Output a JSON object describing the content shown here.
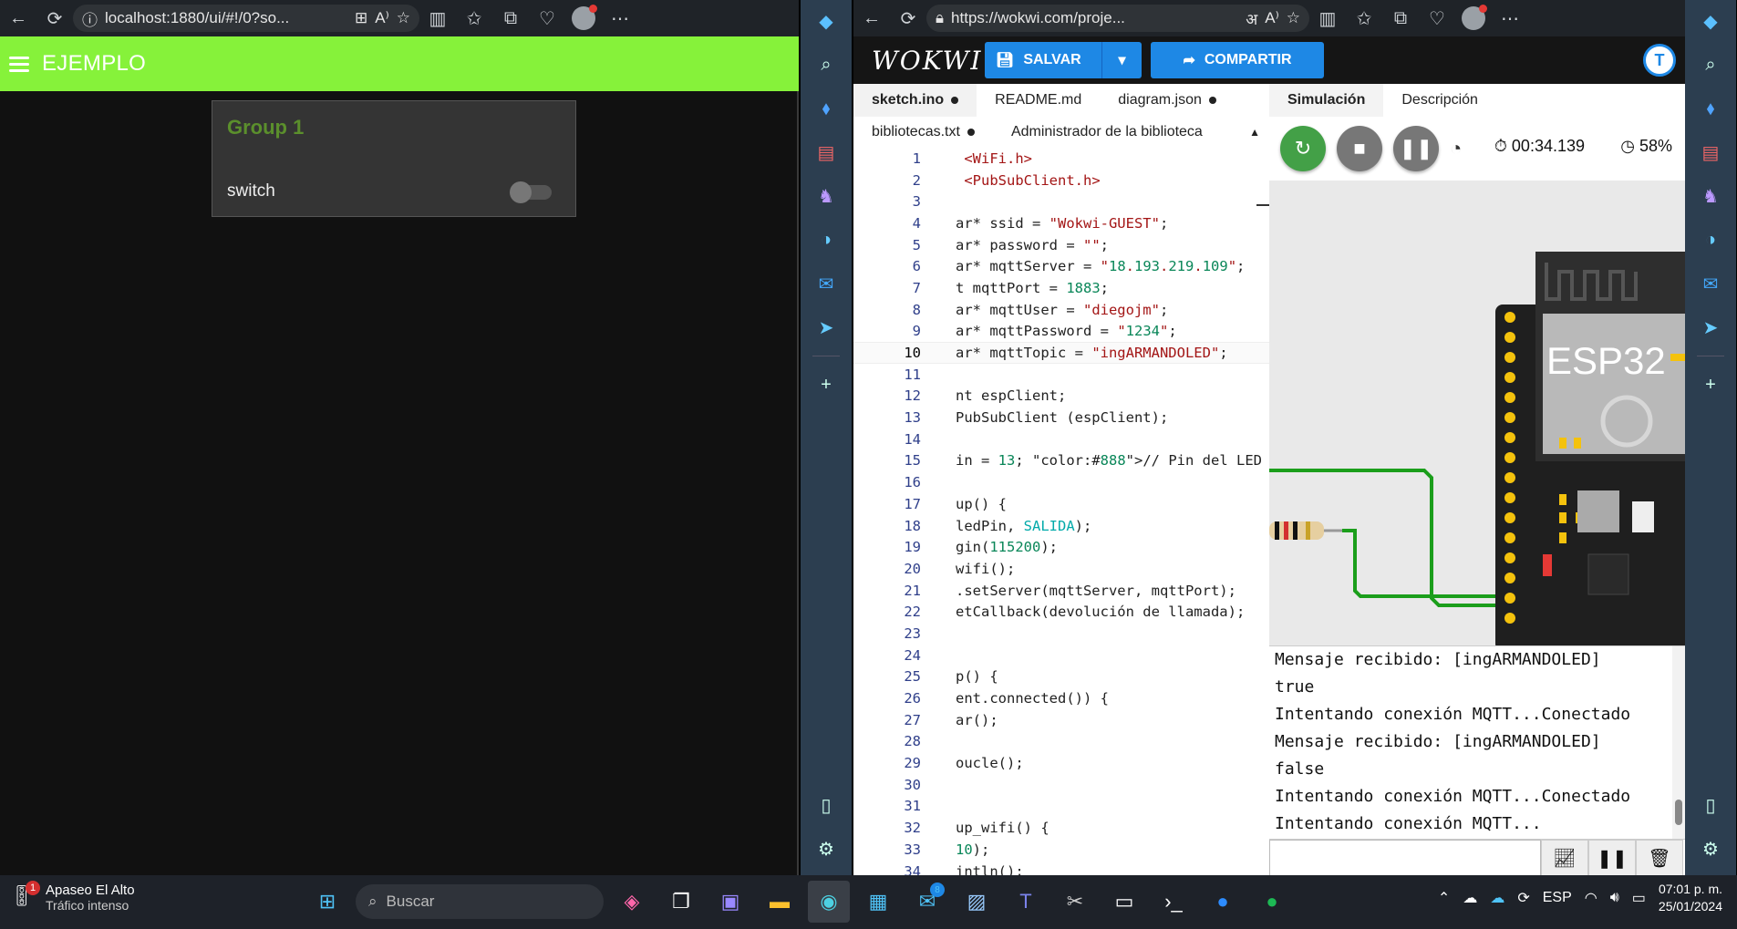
{
  "left_browser": {
    "url": "localhost:1880/ui/#!/0?so...",
    "header_title": "EJEMPLO",
    "group_title": "Group 1",
    "switch_label": "switch",
    "switch_on": false
  },
  "right_browser": {
    "url": "https://wokwi.com/proje...",
    "logo": "WOKWI",
    "save_label": "SALVAR",
    "share_label": "COMPARTIR",
    "user_initial": "T",
    "tabs": [
      {
        "label": "sketch.ino",
        "modified": true
      },
      {
        "label": "README.md",
        "modified": false
      },
      {
        "label": "diagram.json",
        "modified": true
      }
    ],
    "tabs2": [
      {
        "label": "bibliotecas.txt",
        "modified": true
      },
      {
        "label": "Administrador de la biblioteca",
        "modified": false
      }
    ],
    "sim_tabs": [
      "Simulación",
      "Descripción"
    ],
    "sim_time": "00:34.139",
    "sim_perf": "58%",
    "chip_label": "ESP32",
    "code_lines": [
      {
        "n": "1",
        "t": " <WiFi.h>"
      },
      {
        "n": "2",
        "t": " <PubSubClient.h>"
      },
      {
        "n": "3",
        "t": ""
      },
      {
        "n": "4",
        "t": "ar* ssid = \"Wokwi-GUEST\";"
      },
      {
        "n": "5",
        "t": "ar* password = \"\";"
      },
      {
        "n": "6",
        "t": "ar* mqttServer = \"18.193.219.109\";"
      },
      {
        "n": "7",
        "t": "t mqttPort = 1883;"
      },
      {
        "n": "8",
        "t": "ar* mqttUser = \"diegojm\";"
      },
      {
        "n": "9",
        "t": "ar* mqttPassword = \"1234\";"
      },
      {
        "n": "10",
        "t": "ar* mqttTopic = \"ingARMANDOLED\";"
      },
      {
        "n": "11",
        "t": ""
      },
      {
        "n": "12",
        "t": "nt espClient;"
      },
      {
        "n": "13",
        "t": "PubSubClient (espClient);"
      },
      {
        "n": "14",
        "t": ""
      },
      {
        "n": "15",
        "t": "in = 13; // Pin del LED"
      },
      {
        "n": "16",
        "t": ""
      },
      {
        "n": "17",
        "t": "up() {"
      },
      {
        "n": "18",
        "t": "ledPin, SALIDA);"
      },
      {
        "n": "19",
        "t": "gin(115200);"
      },
      {
        "n": "20",
        "t": "wifi();"
      },
      {
        "n": "21",
        "t": ".setServer(mqttServer, mqttPort);"
      },
      {
        "n": "22",
        "t": "etCallback(devolución de llamada);"
      },
      {
        "n": "23",
        "t": ""
      },
      {
        "n": "24",
        "t": ""
      },
      {
        "n": "25",
        "t": "p() {"
      },
      {
        "n": "26",
        "t": "ent.connected()) {"
      },
      {
        "n": "27",
        "t": "ar();"
      },
      {
        "n": "28",
        "t": ""
      },
      {
        "n": "29",
        "t": "oucle();"
      },
      {
        "n": "30",
        "t": ""
      },
      {
        "n": "31",
        "t": ""
      },
      {
        "n": "32",
        "t": "up_wifi() {"
      },
      {
        "n": "33",
        "t": "10);"
      },
      {
        "n": "34",
        "t": "intln();"
      }
    ],
    "console_lines": [
      "Mensaje recibido: [ingARMANDOLED]",
      "true",
      "Intentando conexión MQTT...Conectado",
      "Mensaje recibido: [ingARMANDOLED]",
      "false",
      "Intentando conexión MQTT...Conectado",
      "Intentando conexión MQTT..."
    ]
  },
  "taskbar": {
    "weather_place": "Apaseo El Alto",
    "weather_status": "Tráfico intenso",
    "weather_badge": "1",
    "search_placeholder": "Buscar",
    "mail_badge": "8",
    "lang": "ESP",
    "time": "07:01 p. m.",
    "date": "25/01/2024"
  },
  "colors": {
    "nodered_header": "#86f23a",
    "group_title": "#5b8f2c",
    "wokwi_blue": "#1e88e5",
    "wire_green": "#1b9e1b"
  }
}
